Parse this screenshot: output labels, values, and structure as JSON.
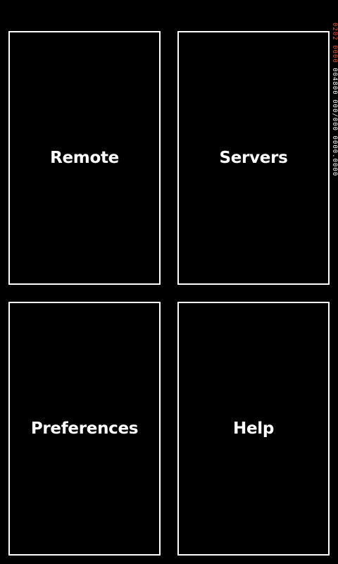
{
  "tiles": [
    {
      "id": "remote",
      "label": "Remote"
    },
    {
      "id": "servers",
      "label": "Servers"
    },
    {
      "id": "preferences",
      "label": "Preferences"
    },
    {
      "id": "help",
      "label": "Help"
    }
  ],
  "frame_rate_counter": {
    "accent_text": "0202 0000",
    "main_text": "004800 000/000 0000.0000",
    "accent_color": "#e2532d",
    "text_color": "#ffffff"
  },
  "colors": {
    "background": "#000000",
    "tile_border": "#ffffff",
    "text": "#ffffff"
  }
}
